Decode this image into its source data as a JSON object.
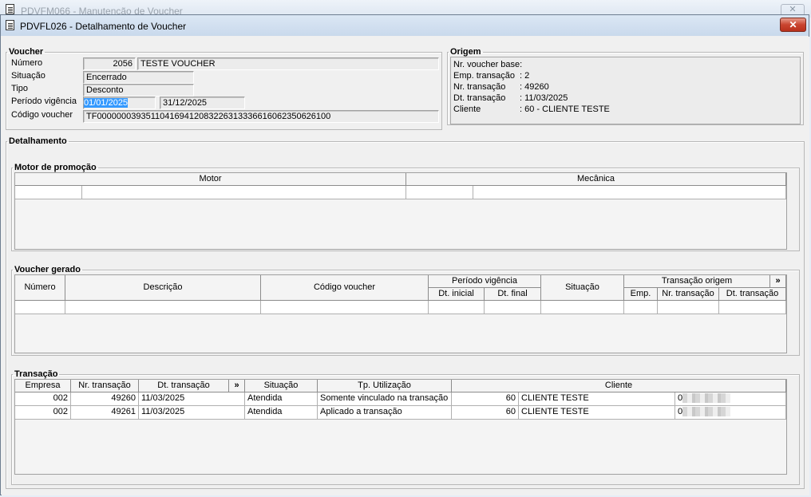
{
  "background_window": {
    "title": "PDVFM066 - Manutenção de Voucher",
    "close": "✕"
  },
  "window": {
    "title": "PDVFL026 - Detalhamento de Voucher",
    "close": "✕"
  },
  "voucher": {
    "legend": "Voucher",
    "numero_label": "Número",
    "numero": "2056",
    "descricao": "TESTE VOUCHER",
    "situacao_label": "Situação",
    "situacao": "Encerrado",
    "tipo_label": "Tipo",
    "tipo": "Desconto",
    "periodo_label": "Período vigência",
    "periodo_inicio": "01/01/2025",
    "periodo_fim": "31/12/2025",
    "codigo_label": "Código voucher",
    "codigo": "TF000000039351104169412083226313336616062350626100"
  },
  "origem": {
    "legend": "Origem",
    "lines": [
      {
        "label": "Nr. voucher base:",
        "value": ""
      },
      {
        "label": "Emp. transação",
        "value": ": 2"
      },
      {
        "label": "Nr. transação",
        "value": ": 49260"
      },
      {
        "label": "Dt. transação",
        "value": ": 11/03/2025"
      },
      {
        "label": "Cliente",
        "value": ": 60 - CLIENTE TESTE"
      }
    ]
  },
  "detalhamento": {
    "legend": "Detalhamento"
  },
  "motor": {
    "legend": "Motor de promoção",
    "col_motor": "Motor",
    "col_mecanica": "Mecânica"
  },
  "voucher_gerado": {
    "legend": "Voucher gerado",
    "col_numero": "Número",
    "col_descricao": "Descrição",
    "col_codigo": "Código voucher",
    "col_periodo": "Período vigência",
    "col_dt_inicial": "Dt. inicial",
    "col_dt_final": "Dt. final",
    "col_situacao": "Situação",
    "col_trans_origem": "Transação origem",
    "expand": "»",
    "col_emp": "Emp.",
    "col_nr_transacao": "Nr. transação",
    "col_dt_transacao": "Dt. transação"
  },
  "transacao": {
    "legend": "Transação",
    "headers": {
      "empresa": "Empresa",
      "nr": "Nr. transação",
      "dt": "Dt. transação",
      "expand": "»",
      "situacao": "Situação",
      "tp": "Tp. Utilização",
      "cliente": "Cliente"
    },
    "rows": [
      {
        "empresa": "002",
        "nr": "49260",
        "dt": "11/03/2025",
        "situacao": "Atendida",
        "tp": "Somente vinculado na transação",
        "cli_cod": "60",
        "cli_nome": "CLIENTE TESTE",
        "doc": "0"
      },
      {
        "empresa": "002",
        "nr": "49261",
        "dt": "11/03/2025",
        "situacao": "Atendida",
        "tp": "Aplicado a transação",
        "cli_cod": "60",
        "cli_nome": "CLIENTE TESTE",
        "doc": "0"
      }
    ]
  }
}
